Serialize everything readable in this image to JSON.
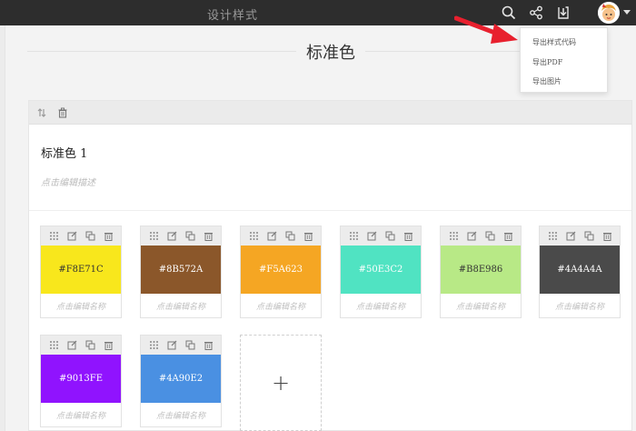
{
  "header": {
    "title": "设计样式",
    "icons": [
      "search-icon",
      "share-icon",
      "download-icon",
      "avatar"
    ]
  },
  "section": {
    "title": "标准色"
  },
  "card": {
    "title": "标准色 1",
    "description_placeholder": "点击编辑描述"
  },
  "swatches": [
    {
      "hex": "#F8E71C",
      "name_placeholder": "点击编辑名称",
      "text_color": "#333333"
    },
    {
      "hex": "#8B572A",
      "name_placeholder": "点击编辑名称",
      "text_color": "#ffffff"
    },
    {
      "hex": "#F5A623",
      "name_placeholder": "点击编辑名称",
      "text_color": "#ffffff"
    },
    {
      "hex": "#50E3C2",
      "name_placeholder": "点击编辑名称",
      "text_color": "#ffffff"
    },
    {
      "hex": "#B8E986",
      "name_placeholder": "点击编辑名称",
      "text_color": "#333333"
    },
    {
      "hex": "#4A4A4A",
      "name_placeholder": "点击编辑名称",
      "text_color": "#ffffff"
    },
    {
      "hex": "#9013FE",
      "name_placeholder": "点击编辑名称",
      "text_color": "#ffffff"
    },
    {
      "hex": "#4A90E2",
      "name_placeholder": "点击编辑名称",
      "text_color": "#ffffff"
    }
  ],
  "add_button": {
    "label": "+"
  },
  "export_menu": {
    "items": [
      "导出样式代码",
      "导出PDF",
      "导出图片"
    ]
  },
  "colors": {
    "topbar": "#2d2d2d",
    "arrow": "#e8202e"
  }
}
